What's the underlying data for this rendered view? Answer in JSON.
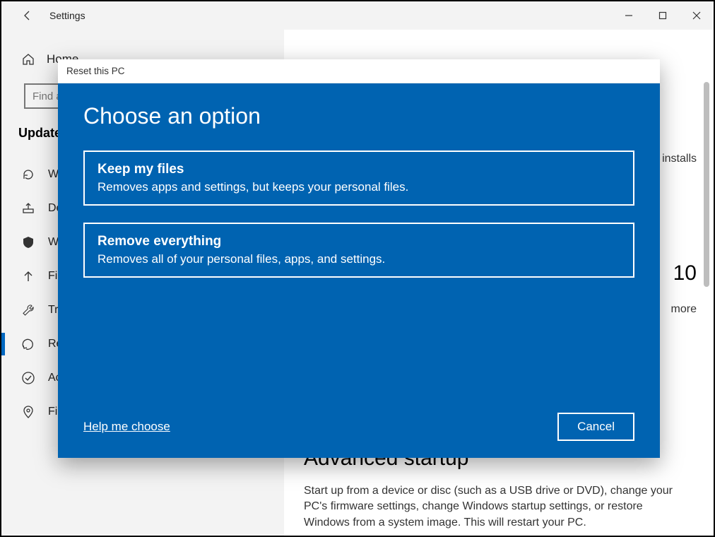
{
  "window": {
    "title": "Settings"
  },
  "sidebar": {
    "home": "Home",
    "search_placeholder": "Find a setting",
    "group_heading": "Update & Security",
    "items": [
      {
        "label": "Windows Update",
        "icon": "refresh"
      },
      {
        "label": "Delivery Optimization",
        "icon": "delivery"
      },
      {
        "label": "Windows Security",
        "icon": "shield"
      },
      {
        "label": "Files backup",
        "icon": "arrow-up"
      },
      {
        "label": "Troubleshoot",
        "icon": "wrench"
      },
      {
        "label": "Recovery",
        "icon": "recovery",
        "selected": true
      },
      {
        "label": "Activation",
        "icon": "check"
      },
      {
        "label": "Find my device",
        "icon": "location"
      }
    ]
  },
  "content": {
    "snip1": "installs",
    "snip2": "10",
    "snip3": "more",
    "section_title": "Advanced startup",
    "section_body": "Start up from a device or disc (such as a USB drive or DVD), change your PC's firmware settings, change Windows startup settings, or restore Windows from a system image. This will restart your PC."
  },
  "modal": {
    "title": "Reset this PC",
    "heading": "Choose an option",
    "options": [
      {
        "title": "Keep my files",
        "desc": "Removes apps and settings, but keeps your personal files."
      },
      {
        "title": "Remove everything",
        "desc": "Removes all of your personal files, apps, and settings."
      }
    ],
    "help_link": "Help me choose",
    "cancel": "Cancel"
  }
}
